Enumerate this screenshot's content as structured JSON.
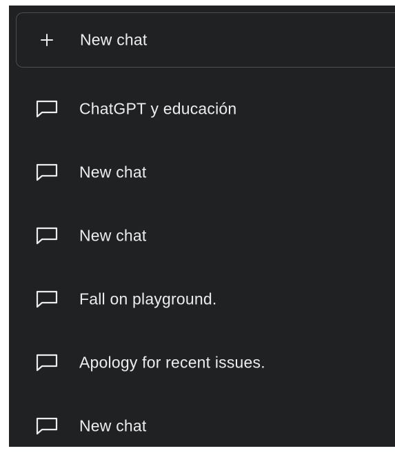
{
  "sidebar": {
    "new_chat": {
      "label": "New chat",
      "icon": "plus-icon"
    },
    "history": [
      {
        "label": "ChatGPT y educación",
        "icon": "chat-bubble-icon"
      },
      {
        "label": "New chat",
        "icon": "chat-bubble-icon"
      },
      {
        "label": "New chat",
        "icon": "chat-bubble-icon"
      },
      {
        "label": "Fall on playground.",
        "icon": "chat-bubble-icon"
      },
      {
        "label": "Apology for recent issues.",
        "icon": "chat-bubble-icon"
      },
      {
        "label": "New chat",
        "icon": "chat-bubble-icon"
      }
    ]
  },
  "colors": {
    "sidebar_bg": "#202123",
    "text": "#ececf1",
    "border": "#4d4d4f"
  }
}
